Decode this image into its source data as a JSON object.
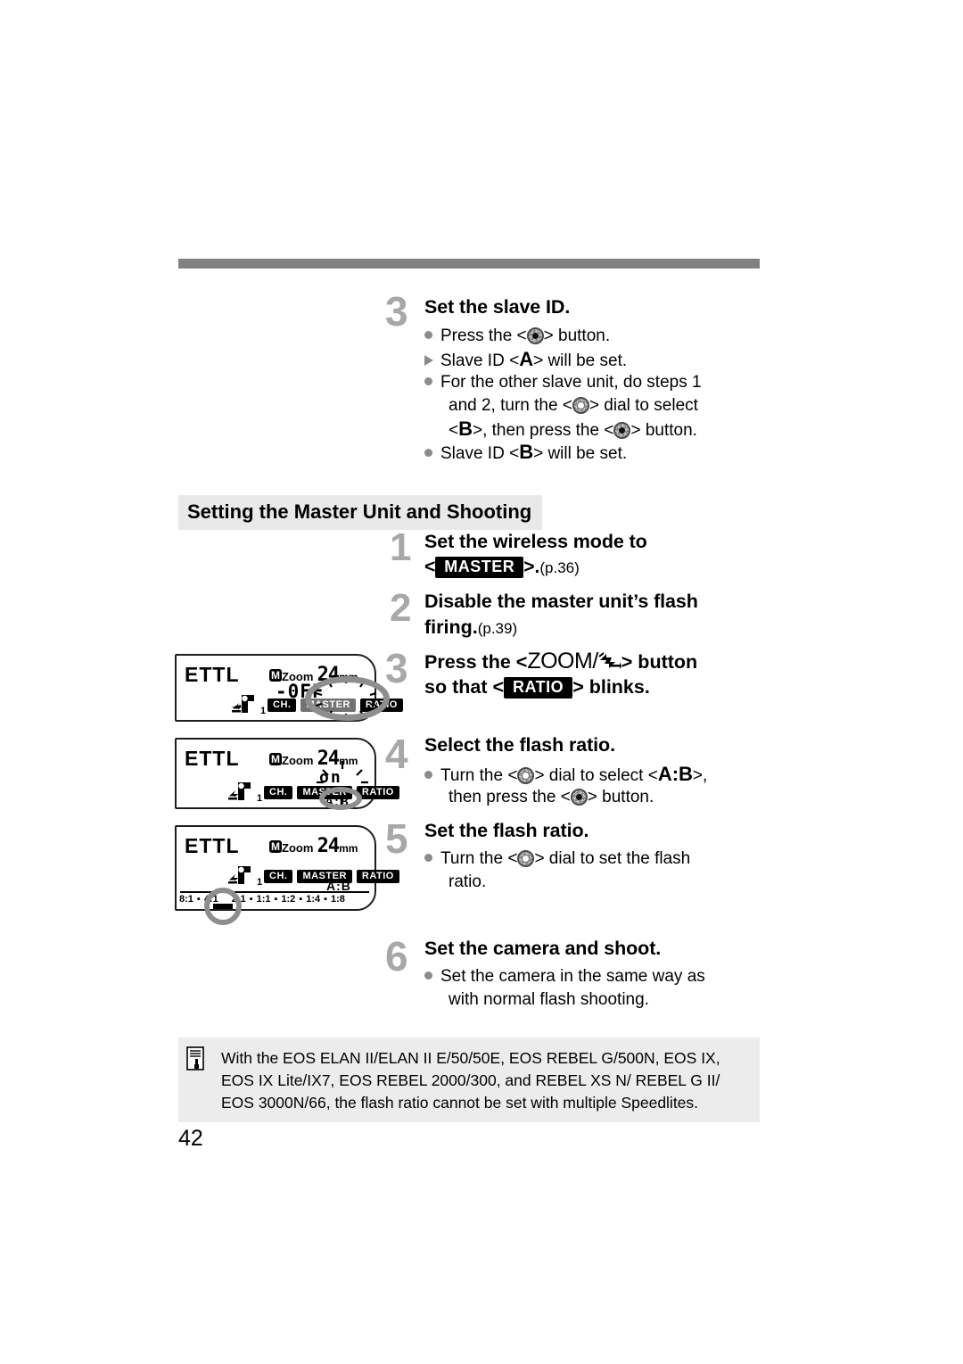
{
  "page": {
    "number": "42"
  },
  "top_section": {
    "step_number": "3",
    "heading": "Set the slave ID.",
    "lines": [
      {
        "marker": "bullet",
        "parts": [
          "Press the <",
          "set-button",
          "> button."
        ]
      },
      {
        "marker": "triangle",
        "parts": [
          "Slave ID <",
          "A",
          "> will be set."
        ]
      },
      {
        "marker": "bullet",
        "parts": [
          "For the other slave unit, do steps 1 and 2, turn the <",
          "dial",
          "> dial to select <",
          "B",
          ">, then press the <",
          "set-button",
          "> button."
        ]
      },
      {
        "marker": "bullet",
        "parts": [
          "Slave ID <",
          "B",
          "> will be set."
        ]
      }
    ],
    "text": {
      "l1_pre": "Press the <",
      "l1_post": "> button.",
      "l2_pre": "Slave ID <",
      "l2_letter": "A",
      "l2_post": "> will be set.",
      "l3a": "For the other slave unit, do steps 1",
      "l3b_pre": "and 2, turn the <",
      "l3b_post": "> dial to select",
      "l3c_pre": "<",
      "l3c_letter": "B",
      "l3c_mid": ">, then press the <",
      "l3c_post": "> button.",
      "l4_pre": "Slave ID <",
      "l4_letter": "B",
      "l4_post": "> will be set."
    }
  },
  "section_heading": "Setting the Master Unit and Shooting",
  "steps": {
    "s1": {
      "number": "1",
      "heading_line1": "Set the wireless mode to",
      "bracket_open": "<",
      "badge": "MASTER",
      "bracket_close": ">.",
      "page_ref": "(p.36)"
    },
    "s2": {
      "number": "2",
      "heading_line1": "Disable the master unit’s flash",
      "heading_line2": "firing.",
      "page_ref": "(p.39)"
    },
    "s3": {
      "number": "3",
      "line1_pre": "Press the <",
      "zoom_label": "ZOOM/",
      "line1_post": "> button",
      "line2_pre": "so that <",
      "badge": "RATIO",
      "line2_post": "> blinks."
    },
    "s4": {
      "number": "4",
      "heading": "Select the flash ratio.",
      "b1_pre": "Turn the <",
      "b1_mid": "> dial to select <",
      "b1_ab": "A:B",
      "b1_post": ">,",
      "b2_pre": "then press the <",
      "b2_post": "> button."
    },
    "s5": {
      "number": "5",
      "heading": "Set the flash ratio.",
      "b1_pre": "Turn the <",
      "b1_post": "> dial to set the flash",
      "b2": "ratio."
    },
    "s6": {
      "number": "6",
      "heading": "Set the camera and shoot.",
      "b1": "Set the camera in the same way as",
      "b2": "with normal flash shooting."
    }
  },
  "lcd_panels": [
    {
      "id": "lcd-ratio-off",
      "mode": "ETTL",
      "m_badge": "M",
      "zoom_label": "Zoom",
      "zoom_value": "24",
      "zoom_unit": "mm",
      "value": "-0FF",
      "tags": [
        "CH.",
        "MASTER",
        "RATIO"
      ],
      "channel": "1",
      "highlight": "RATIO",
      "blinking": true
    },
    {
      "id": "lcd-ratio-on",
      "mode": "ETTL",
      "m_badge": "M",
      "zoom_label": "Zoom",
      "zoom_value": "24",
      "zoom_unit": "mm",
      "value": "on",
      "tags": [
        "CH.",
        "MASTER",
        "RATIO"
      ],
      "channel": "1",
      "ab": "A:B",
      "highlight": "A:B",
      "blinking": true
    },
    {
      "id": "lcd-ratio-scale",
      "mode": "ETTL",
      "m_badge": "M",
      "zoom_label": "Zoom",
      "zoom_value": "24",
      "zoom_unit": "mm",
      "tags": [
        "CH.",
        "MASTER",
        "RATIO"
      ],
      "channel": "1",
      "ab": "A:B",
      "scale": [
        "8:1",
        "4:1",
        "2:1",
        "1:1",
        "1:2",
        "1:4",
        "1:8"
      ],
      "selected_ratio": "4:1",
      "highlight": "4:1"
    }
  ],
  "note": {
    "line1": "With the EOS ELAN II/ELAN II E/50/50E, EOS REBEL G/500N, EOS IX,",
    "line2": "EOS IX Lite/IX7, EOS REBEL 2000/300, and REBEL XS N/ REBEL G II/",
    "line3": "EOS 3000N/66, the flash ratio cannot be set with multiple Speedlites."
  },
  "colors": {
    "rule_gray": "#808080",
    "section_band": "#e9e9e9",
    "note_bg": "#ececec",
    "step_number_gray": "#a8a8a8",
    "highlight_gray": "#8e8e8e"
  }
}
